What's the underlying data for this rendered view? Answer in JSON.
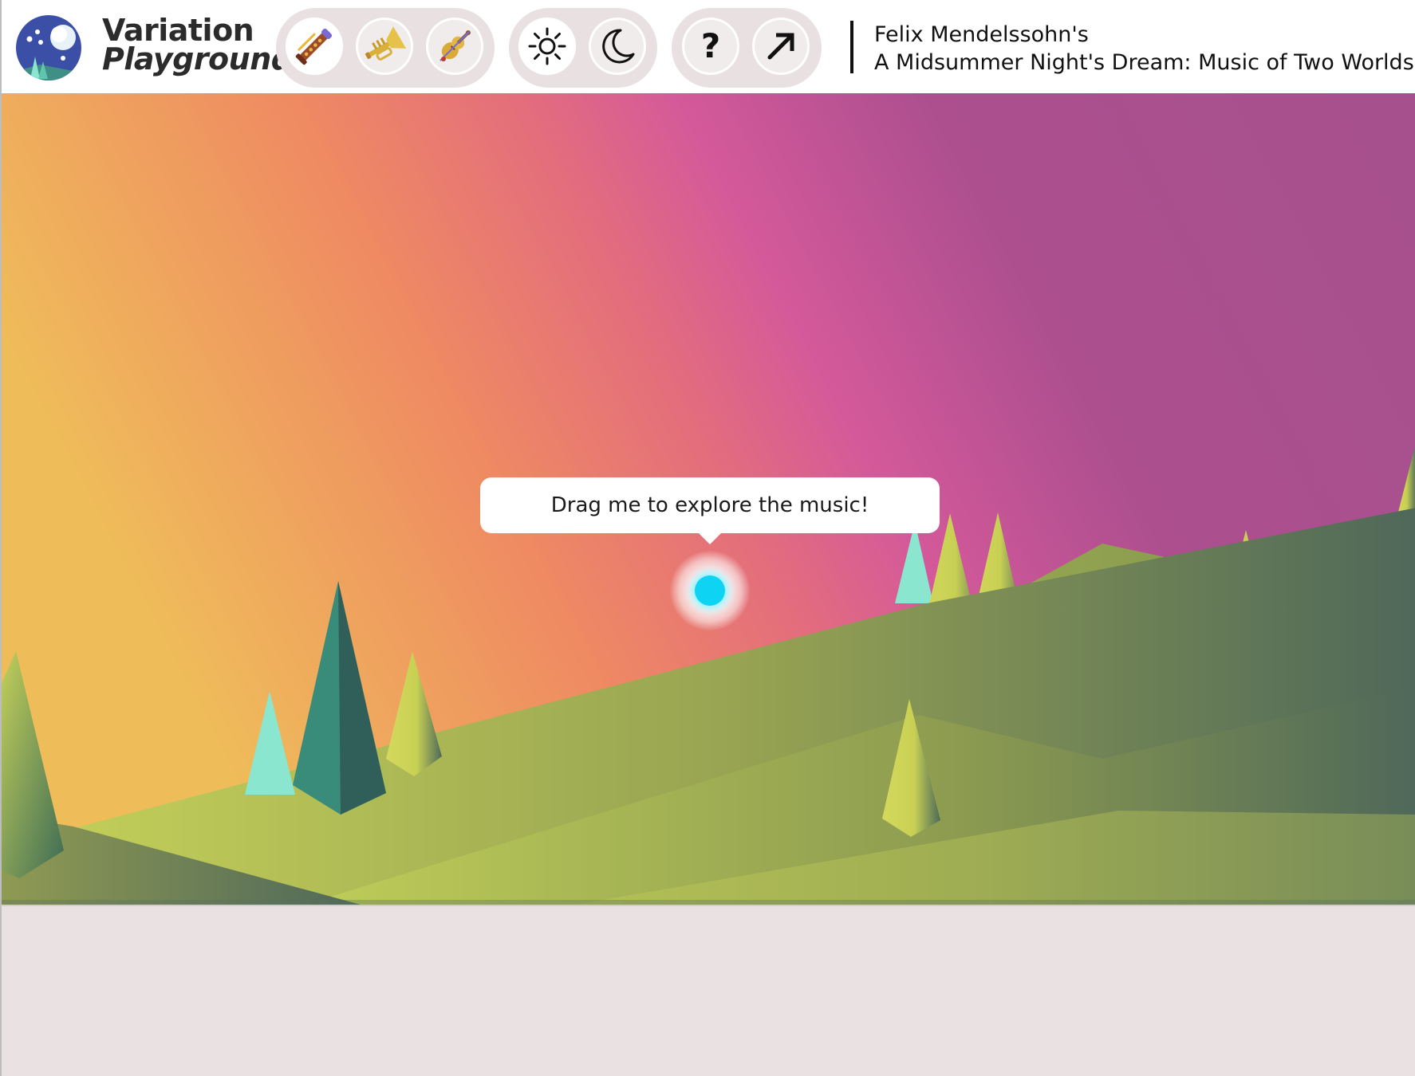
{
  "app": {
    "title_line1": "Variation",
    "title_line2": "Playground"
  },
  "toolbar": {
    "instrument_buttons": [
      {
        "icon": "clarinet-icon"
      },
      {
        "icon": "trumpet-icon"
      },
      {
        "icon": "violin-icon"
      }
    ],
    "mode_buttons": [
      {
        "icon": "sun-icon"
      },
      {
        "icon": "moon-icon"
      }
    ],
    "help_label": "?",
    "share_icon": "arrow-up-right-icon"
  },
  "piece": {
    "composer": "Felix Mendelssohn's",
    "title": "A Midsummer Night's Dream: Music of Two Worlds"
  },
  "stage": {
    "tooltip": "Drag me to explore the music!",
    "handle_color": "#0fd3f2"
  },
  "colors": {
    "sky_left": "#efbc5a",
    "sky_mid": "#d45a98",
    "sky_right": "#a44e8f",
    "hill_light": "#c4d05a",
    "hill_dark": "#4f6859",
    "tree_teal": "#3a8c7a",
    "tree_mint": "#8be6cf"
  }
}
